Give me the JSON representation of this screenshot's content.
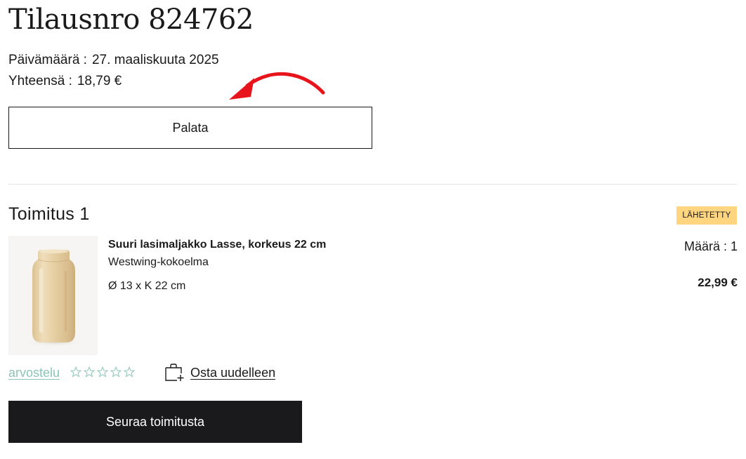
{
  "order": {
    "title": "Tilausnro 824762",
    "date_label": "Päivämäärä :",
    "date_value": "27. maaliskuuta 2025",
    "total_label": "Yhteensä :",
    "total_value": "18,79 €",
    "return_button_label": "Palata"
  },
  "annotation": {
    "icon": "curved-arrow-icon",
    "color": "#e8141b"
  },
  "delivery": {
    "title": "Toimitus 1",
    "status": "LÄHETETTY",
    "status_color": "#ffd580",
    "item": {
      "image_icon": "glass-vase-image",
      "name": "Suuri lasimaljakko Lasse, korkeus 22 cm",
      "collection": "Westwing-kokoelma",
      "dimensions": "Ø 13 x K 22 cm",
      "quantity_label": "Määrä :",
      "quantity_value": "1",
      "price": "22,99 €"
    },
    "review_link": "arvostelu",
    "review_link_color": "#8cc4b7",
    "rating": {
      "value": 0,
      "max": 5,
      "icon": "star-outline-icon"
    },
    "rebuy_icon": "bag-plus-icon",
    "rebuy_label": "Osta uudelleen",
    "track_button_label": "Seuraa toimitusta",
    "track_button_color": "#1a1a1c"
  }
}
